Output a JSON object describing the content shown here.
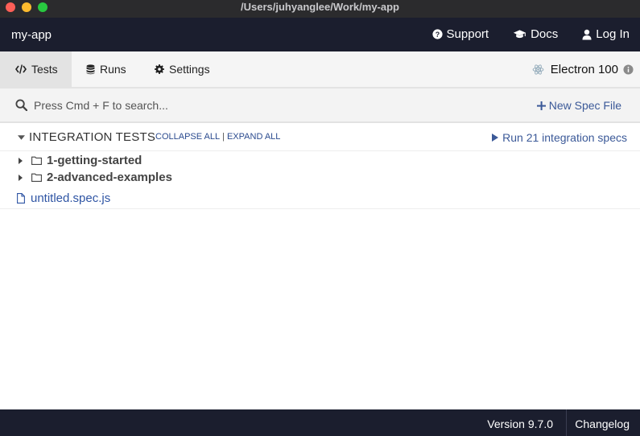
{
  "window": {
    "title": "/Users/juhyanglee/Work/my-app"
  },
  "appbar": {
    "project": "my-app",
    "links": [
      {
        "label": "Support",
        "icon": "question-circle-icon"
      },
      {
        "label": "Docs",
        "icon": "graduation-cap-icon"
      },
      {
        "label": "Log In",
        "icon": "user-icon"
      }
    ]
  },
  "nav": {
    "tabs": [
      {
        "label": "Tests",
        "icon": "code-icon",
        "active": true
      },
      {
        "label": "Runs",
        "icon": "database-icon",
        "active": false
      },
      {
        "label": "Settings",
        "icon": "gear-icon",
        "active": false
      }
    ],
    "browser": {
      "label": "Electron 100",
      "icon": "electron-icon",
      "info_icon": "info-icon"
    }
  },
  "search": {
    "placeholder": "Press Cmd + F to search...",
    "value": "",
    "new_spec_label": "New Spec File"
  },
  "specs": {
    "section_title": "INTEGRATION TESTS",
    "collapse_all": "COLLAPSE ALL",
    "separator": "|",
    "expand_all": "EXPAND ALL",
    "run_all_label": "Run 21 integration specs",
    "folders": [
      {
        "name": "1-getting-started"
      },
      {
        "name": "2-advanced-examples"
      }
    ],
    "files": [
      {
        "name": "untitled.spec.js"
      }
    ]
  },
  "footer": {
    "version": "Version 9.7.0",
    "changelog": "Changelog"
  },
  "colors": {
    "header_bg": "#1b1e2e",
    "link_blue": "#3b5998",
    "active_tab": "#e3e3e3"
  }
}
